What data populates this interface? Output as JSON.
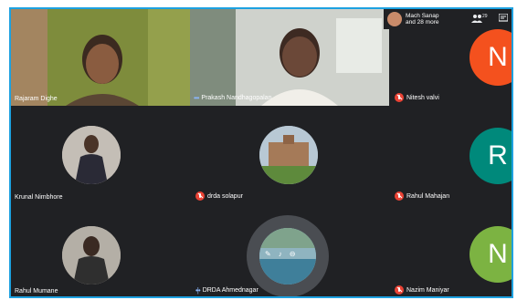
{
  "participants": {
    "p1": {
      "name": "Rajaram Dighe"
    },
    "p2": {
      "name": "Prakash Nandhagopalan"
    },
    "p3": {
      "name": "Nitesh valvi",
      "initial": "N",
      "color": "#f4511e"
    },
    "p4": {
      "name": "Krunal Nimbhore"
    },
    "p5": {
      "name": "drda solapur"
    },
    "p6": {
      "name": "Rahul Mahajan",
      "initial": "R",
      "color": "#00897b"
    },
    "p7": {
      "name": "Rahul Mumane"
    },
    "p8": {
      "name": "DRDA Ahmednagar"
    },
    "p9": {
      "name": "Nazim Maniyar",
      "initial": "N",
      "color": "#7cb342"
    }
  },
  "top_bar": {
    "people_text_1": "Mach Sanap",
    "people_text_2": "and 28 more",
    "count": "29"
  }
}
